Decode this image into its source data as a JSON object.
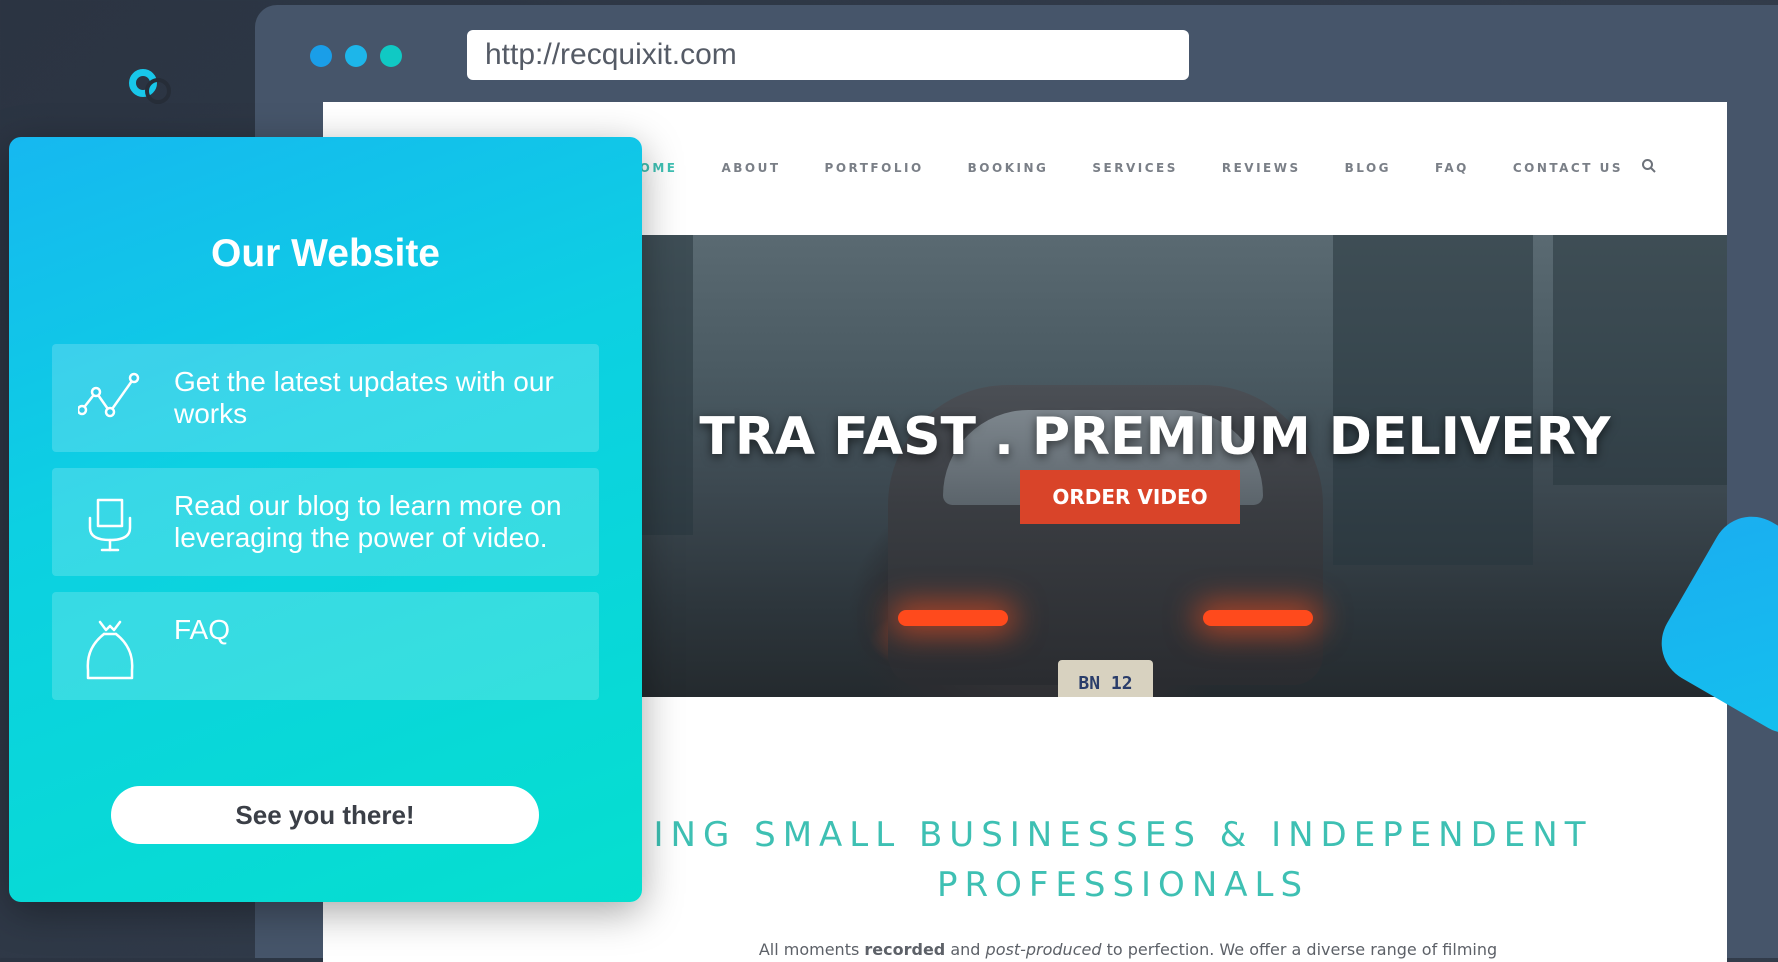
{
  "browser": {
    "url": "http://recquixit.com",
    "window_dots": [
      "#1a9ee8",
      "#1db6ea",
      "#10c9c4"
    ]
  },
  "site": {
    "nav": [
      "HOME",
      "ABOUT",
      "PORTFOLIO",
      "BOOKING",
      "SERVICES",
      "REVIEWS",
      "BLOG",
      "FAQ",
      "CONTACT US"
    ],
    "active_nav": "HOME",
    "hero_headline": "TRA FAST . PREMIUM DELIVERY",
    "hero_button": "ORDER VIDEO",
    "plate_text": "BN  12",
    "section_title": "ING SMALL BUSINESSES & INDEPENDENT PROFESSIONALS",
    "intro_prefix": "All moments ",
    "intro_bold": "recorded",
    "intro_mid": " and ",
    "intro_italic": "post-produced",
    "intro_suffix": " to perfection. We offer a diverse range of filming"
  },
  "panel": {
    "title": "Our Website",
    "items": [
      {
        "icon": "trend-line-icon",
        "text": "Get the latest updates with our works"
      },
      {
        "icon": "chair-icon",
        "text": "Read our blog to learn more on leveraging the power of video."
      },
      {
        "icon": "bag-icon",
        "text": "FAQ"
      }
    ],
    "cta": "See you there!"
  },
  "colors": {
    "accent_teal": "#3ec0b3",
    "order_button": "#d94429",
    "panel_gradient_start": "#16b8f0",
    "panel_gradient_end": "#05dfcf"
  }
}
